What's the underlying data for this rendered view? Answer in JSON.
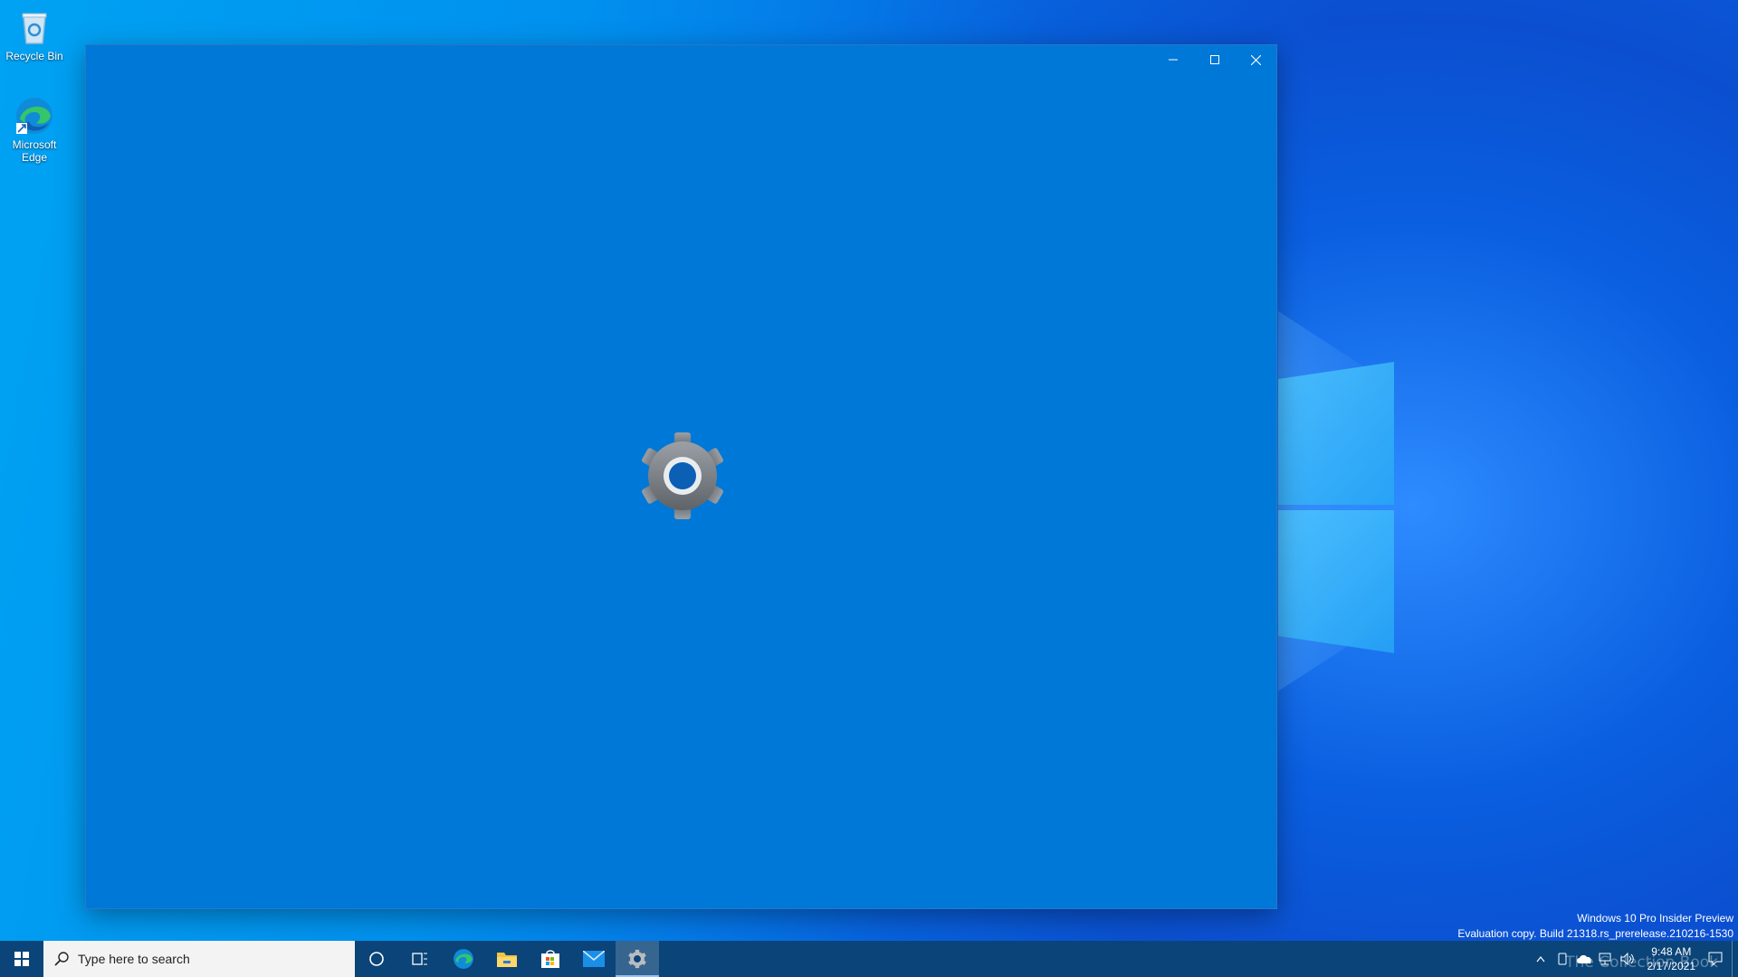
{
  "desktop": {
    "icons": [
      {
        "label": "Recycle Bin",
        "icon": "recycle-bin-icon"
      },
      {
        "label": "Microsoft Edge",
        "icon": "edge-icon"
      }
    ],
    "watermark": {
      "line1": "Windows 10 Pro Insider Preview",
      "line2": "Evaluation copy. Build 21318.rs_prerelease.210216-1530"
    },
    "overlay_text": "The Collection Book"
  },
  "window": {
    "app": "Settings",
    "state": "splash-loading",
    "background": "#0078d7",
    "splash_icon": "settings-gear-icon",
    "caption_buttons": [
      "minimize",
      "maximize",
      "close"
    ]
  },
  "taskbar": {
    "search_placeholder": "Type here to search",
    "pinned": [
      {
        "icon": "cortana-icon"
      },
      {
        "icon": "task-view-icon"
      },
      {
        "icon": "edge-icon"
      },
      {
        "icon": "file-explorer-icon"
      },
      {
        "icon": "microsoft-store-icon"
      },
      {
        "icon": "mail-icon"
      },
      {
        "icon": "settings-icon",
        "active": true
      }
    ],
    "tray": {
      "time": "9:48 AM",
      "date": "2/17/2021"
    }
  },
  "colors": {
    "accent": "#0078d7",
    "taskbar": "#0a4478"
  }
}
